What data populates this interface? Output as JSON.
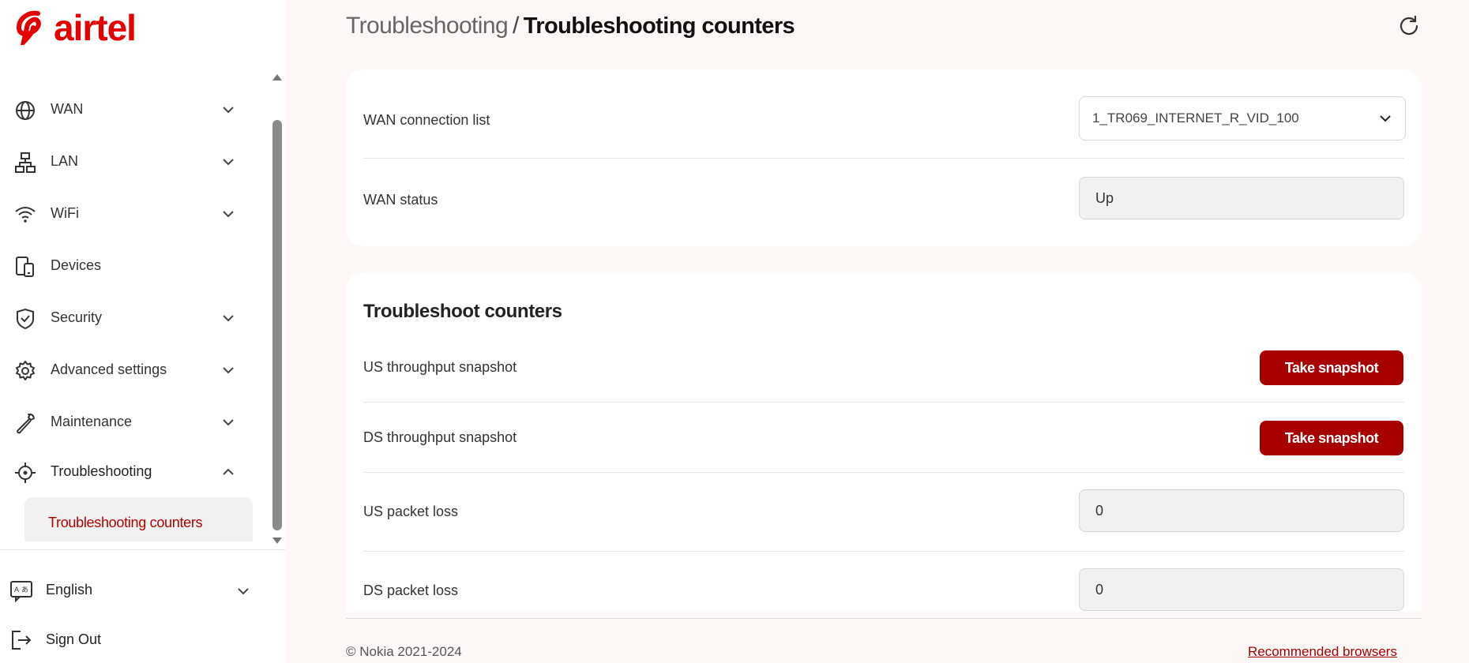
{
  "brand": {
    "name": "airtel",
    "color": "#e40000"
  },
  "sidebar": {
    "items": [
      {
        "label": "WAN",
        "icon": "globe-icon",
        "expandable": true
      },
      {
        "label": "LAN",
        "icon": "network-icon",
        "expandable": true
      },
      {
        "label": "WiFi",
        "icon": "wifi-icon",
        "expandable": true
      },
      {
        "label": "Devices",
        "icon": "devices-icon",
        "expandable": false
      },
      {
        "label": "Security",
        "icon": "shield-icon",
        "expandable": true
      },
      {
        "label": "Advanced settings",
        "icon": "gear-icon",
        "expandable": true
      },
      {
        "label": "Maintenance",
        "icon": "wrench-icon",
        "expandable": true
      },
      {
        "label": "Troubleshooting",
        "icon": "crosshair-icon",
        "expandable": true,
        "expanded": true
      }
    ],
    "subitem": {
      "label": "Troubleshooting counters",
      "active": true
    },
    "language": {
      "label": "English",
      "icon": "translate-icon"
    },
    "signout": {
      "label": "Sign Out",
      "icon": "sign-out-icon"
    }
  },
  "header": {
    "breadcrumb_parent": "Troubleshooting",
    "breadcrumb_separator": "/",
    "breadcrumb_current": "Troubleshooting counters",
    "refresh_icon": "refresh-icon"
  },
  "wan_card": {
    "connection_label": "WAN connection list",
    "connection_value": "1_TR069_INTERNET_R_VID_100",
    "status_label": "WAN status",
    "status_value": "Up"
  },
  "counters": {
    "title": "Troubleshoot counters",
    "us_throughput_label": "US throughput snapshot",
    "ds_throughput_label": "DS throughput snapshot",
    "snapshot_button": "Take snapshot",
    "us_packet_loss_label": "US packet loss",
    "us_packet_loss_value": "0",
    "ds_packet_loss_label": "DS packet loss",
    "ds_packet_loss_value": "0"
  },
  "footer": {
    "copyright": "© Nokia 2021-2024",
    "recommended_browsers": "Recommended browsers"
  },
  "colors": {
    "accent": "#a80000",
    "active_text": "#b30000",
    "background": "#fdf8f6"
  }
}
